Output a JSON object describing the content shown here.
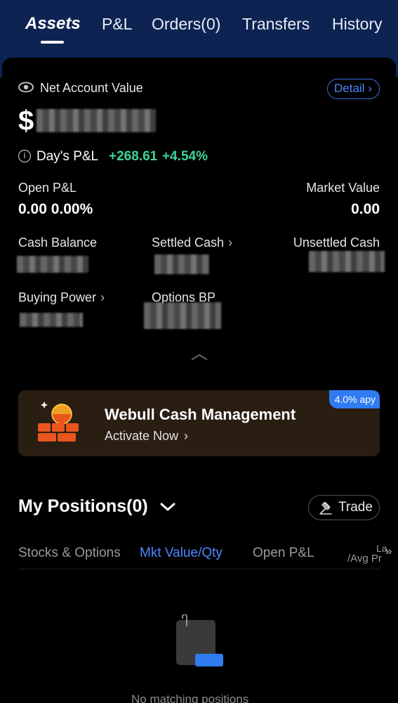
{
  "tabs": [
    {
      "label": "Assets",
      "active": true
    },
    {
      "label": "P&L",
      "active": false
    },
    {
      "label": "Orders(0)",
      "active": false
    },
    {
      "label": "Transfers",
      "active": false
    },
    {
      "label": "History",
      "active": false
    }
  ],
  "account": {
    "net_value_label": "Net Account Value",
    "detail_label": "Detail",
    "net_value_prefix": "$",
    "day_pl_label": "Day's P&L",
    "day_pl_amount": "+268.61",
    "day_pl_percent": "+4.54%",
    "open_pl_label": "Open P&L",
    "open_pl_value": "0.00 0.00%",
    "market_value_label": "Market Value",
    "market_value": "0.00",
    "cash_balance_label": "Cash Balance",
    "settled_cash_label": "Settled Cash",
    "unsettled_cash_label": "Unsettled Cash",
    "buying_power_label": "Buying Power",
    "options_bp_label": "Options BP"
  },
  "banner": {
    "title": "Webull Cash Management",
    "subtitle": "Activate Now",
    "badge": "4.0% apy"
  },
  "positions": {
    "title": "My Positions(0)",
    "trade_label": "Trade",
    "columns": [
      "Stocks & Options",
      "Mkt Value/Qty",
      "Open P&L"
    ],
    "last_col_top": "La",
    "last_col_bottom": "/Avg Pr",
    "empty_text": "No matching positions"
  },
  "colors": {
    "accent": "#4c86ff",
    "positive": "#3dd39a",
    "header_bg": "#0d2452",
    "banner_bg": "#2a1d12",
    "badge_bg": "#2f7bf2"
  }
}
